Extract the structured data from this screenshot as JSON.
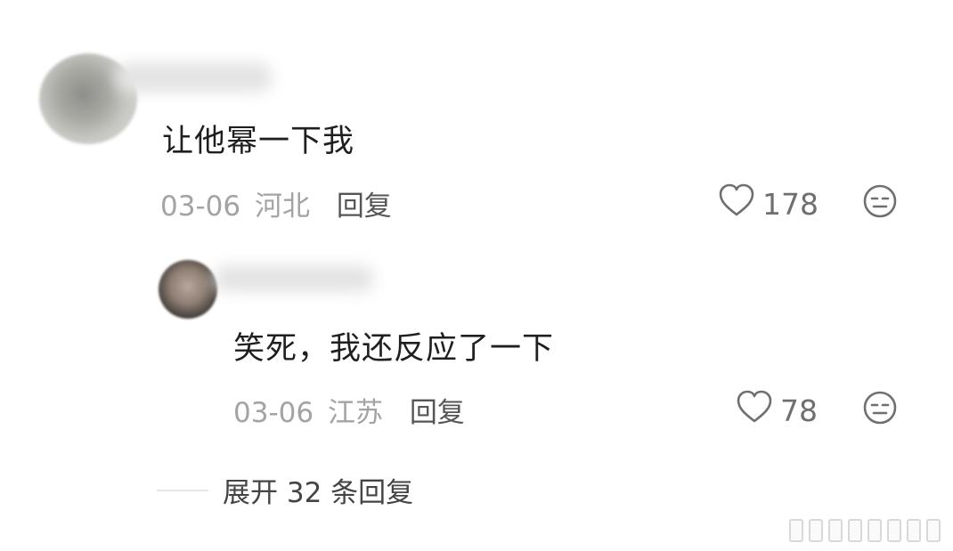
{
  "comment": {
    "text": "让他幂一下我",
    "date": "03-06",
    "location": "河北",
    "reply_label": "回复",
    "likes": "178"
  },
  "reply": {
    "text": "笑死，我还反应了一下",
    "date": "03-06",
    "location": "江苏",
    "reply_label": "回复",
    "likes": "78"
  },
  "expand": {
    "label": "展开 32 条回复"
  },
  "icons": {
    "like": "heart-icon",
    "dislike": "meh-face-icon"
  },
  "colors": {
    "text": "#1f1f1f",
    "meta": "#a3a3a3",
    "icon": "#6f6f6f",
    "background": "#ffffff"
  }
}
